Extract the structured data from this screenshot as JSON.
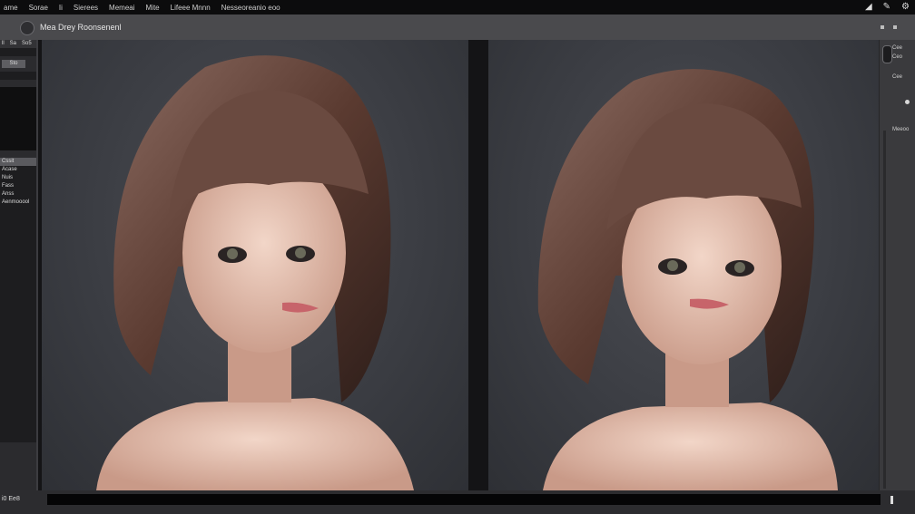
{
  "menubar": {
    "items": [
      "ame",
      "Sorae",
      "Ii",
      "Sierees",
      "Memeai",
      "Mite",
      "Lifeee Mnnn",
      "Nesseoreanio eoo"
    ],
    "tray_icons": [
      "wifi-icon",
      "sync-icon",
      "settings-icon"
    ]
  },
  "toolbar": {
    "title": "Mea Drey Roonsenenl"
  },
  "left_panel": {
    "tabs": [
      "ll",
      "Sa",
      "So5"
    ],
    "button": "Sto",
    "items": [
      "Cssit",
      "Acase",
      "Nuis",
      "Fass",
      "Anss",
      "Aenmooool"
    ]
  },
  "right_panel": {
    "labels": [
      "Cee",
      "Ceo",
      "Cee",
      "Meeoo"
    ]
  },
  "statusbar": {
    "zoom": "i0  Ee8"
  },
  "colors": {
    "background": "#1a1a1c",
    "toolbar": "#4a4a4d",
    "canvas_bg": "#3b3d43",
    "hair": "#5a3a30",
    "skin": "#e8c2b0"
  }
}
